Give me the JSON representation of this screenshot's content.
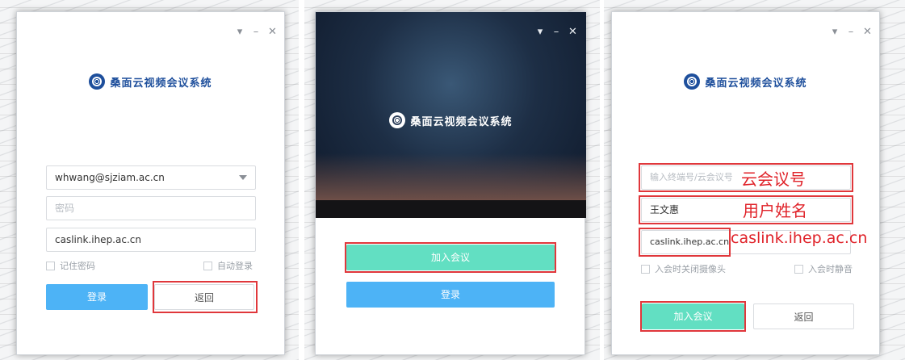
{
  "window_controls": {
    "menu_icon": "chevron-down-icon",
    "minimize_icon": "minimize-icon",
    "close_icon": "close-icon"
  },
  "brand": {
    "logo_text": "桑面云视频会议系统"
  },
  "panel_login": {
    "account_value": "whwang@sjziam.ac.cn",
    "password_placeholder": "密码",
    "server_value": "caslink.ihep.ac.cn",
    "remember_label": "记住密码",
    "autologin_label": "自动登录",
    "login_button": "登录",
    "back_button": "返回"
  },
  "panel_start": {
    "join_button": "加入会议",
    "login_button": "登录"
  },
  "panel_join": {
    "meeting_placeholder": "输入终端号/云会议号",
    "username_value": "王文惠",
    "server_value": "caslink.ihep.ac.cn",
    "camera_off_label": "入会时关闭摄像头",
    "mute_label": "入会时静音",
    "join_button": "加入会议",
    "back_button": "返回"
  },
  "annotations": {
    "meeting_id": "云会议号",
    "user_name": "用户姓名",
    "server": "caslink.ihep.ac.cn"
  },
  "colors": {
    "annotation_red": "#e0232a",
    "button_blue": "#4db3f6",
    "button_green": "#62dfc2",
    "brand_blue": "#1e4f9c"
  }
}
